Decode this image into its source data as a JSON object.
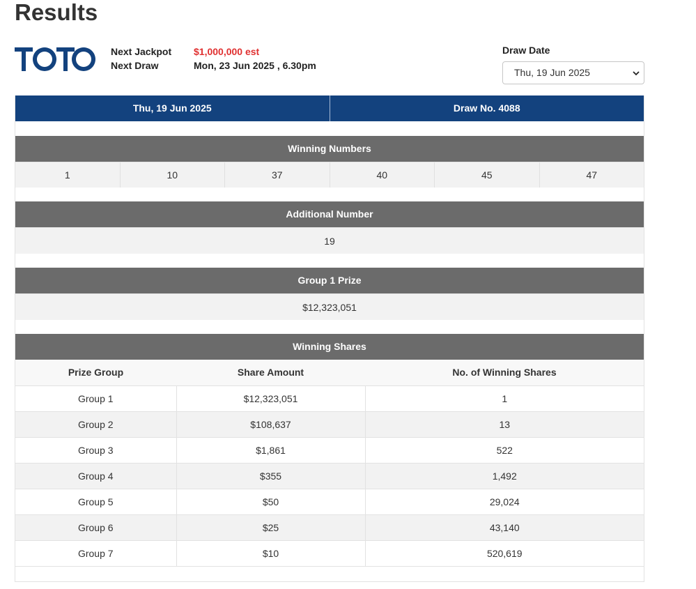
{
  "page": {
    "title": "Results"
  },
  "logo": {
    "text": "TOTO",
    "color": "#13427e"
  },
  "info": {
    "jackpot_label": "Next Jackpot",
    "jackpot_value": "$1,000,000 est",
    "draw_label": "Next Draw",
    "draw_value": "Mon, 23 Jun 2025 , 6.30pm"
  },
  "draw_date": {
    "label": "Draw Date",
    "selected": "Thu, 19 Jun 2025"
  },
  "header": {
    "date": "Thu, 19 Jun 2025",
    "draw_no": "Draw No. 4088"
  },
  "winning_numbers": {
    "title": "Winning Numbers",
    "values": [
      "1",
      "10",
      "37",
      "40",
      "45",
      "47"
    ]
  },
  "additional": {
    "title": "Additional Number",
    "value": "19"
  },
  "group1": {
    "title": "Group 1 Prize",
    "value": "$12,323,051"
  },
  "shares": {
    "title": "Winning Shares",
    "columns": [
      "Prize Group",
      "Share Amount",
      "No. of Winning Shares"
    ],
    "rows": [
      [
        "Group 1",
        "$12,323,051",
        "1"
      ],
      [
        "Group 2",
        "$108,637",
        "13"
      ],
      [
        "Group 3",
        "$1,861",
        "522"
      ],
      [
        "Group 4",
        "$355",
        "1,492"
      ],
      [
        "Group 5",
        "$50",
        "29,024"
      ],
      [
        "Group 6",
        "$25",
        "43,140"
      ],
      [
        "Group 7",
        "$10",
        "520,619"
      ]
    ]
  },
  "colors": {
    "header_blue": "#13427e",
    "section_grey": "#6b6b6b",
    "jackpot_red": "#e03030"
  }
}
